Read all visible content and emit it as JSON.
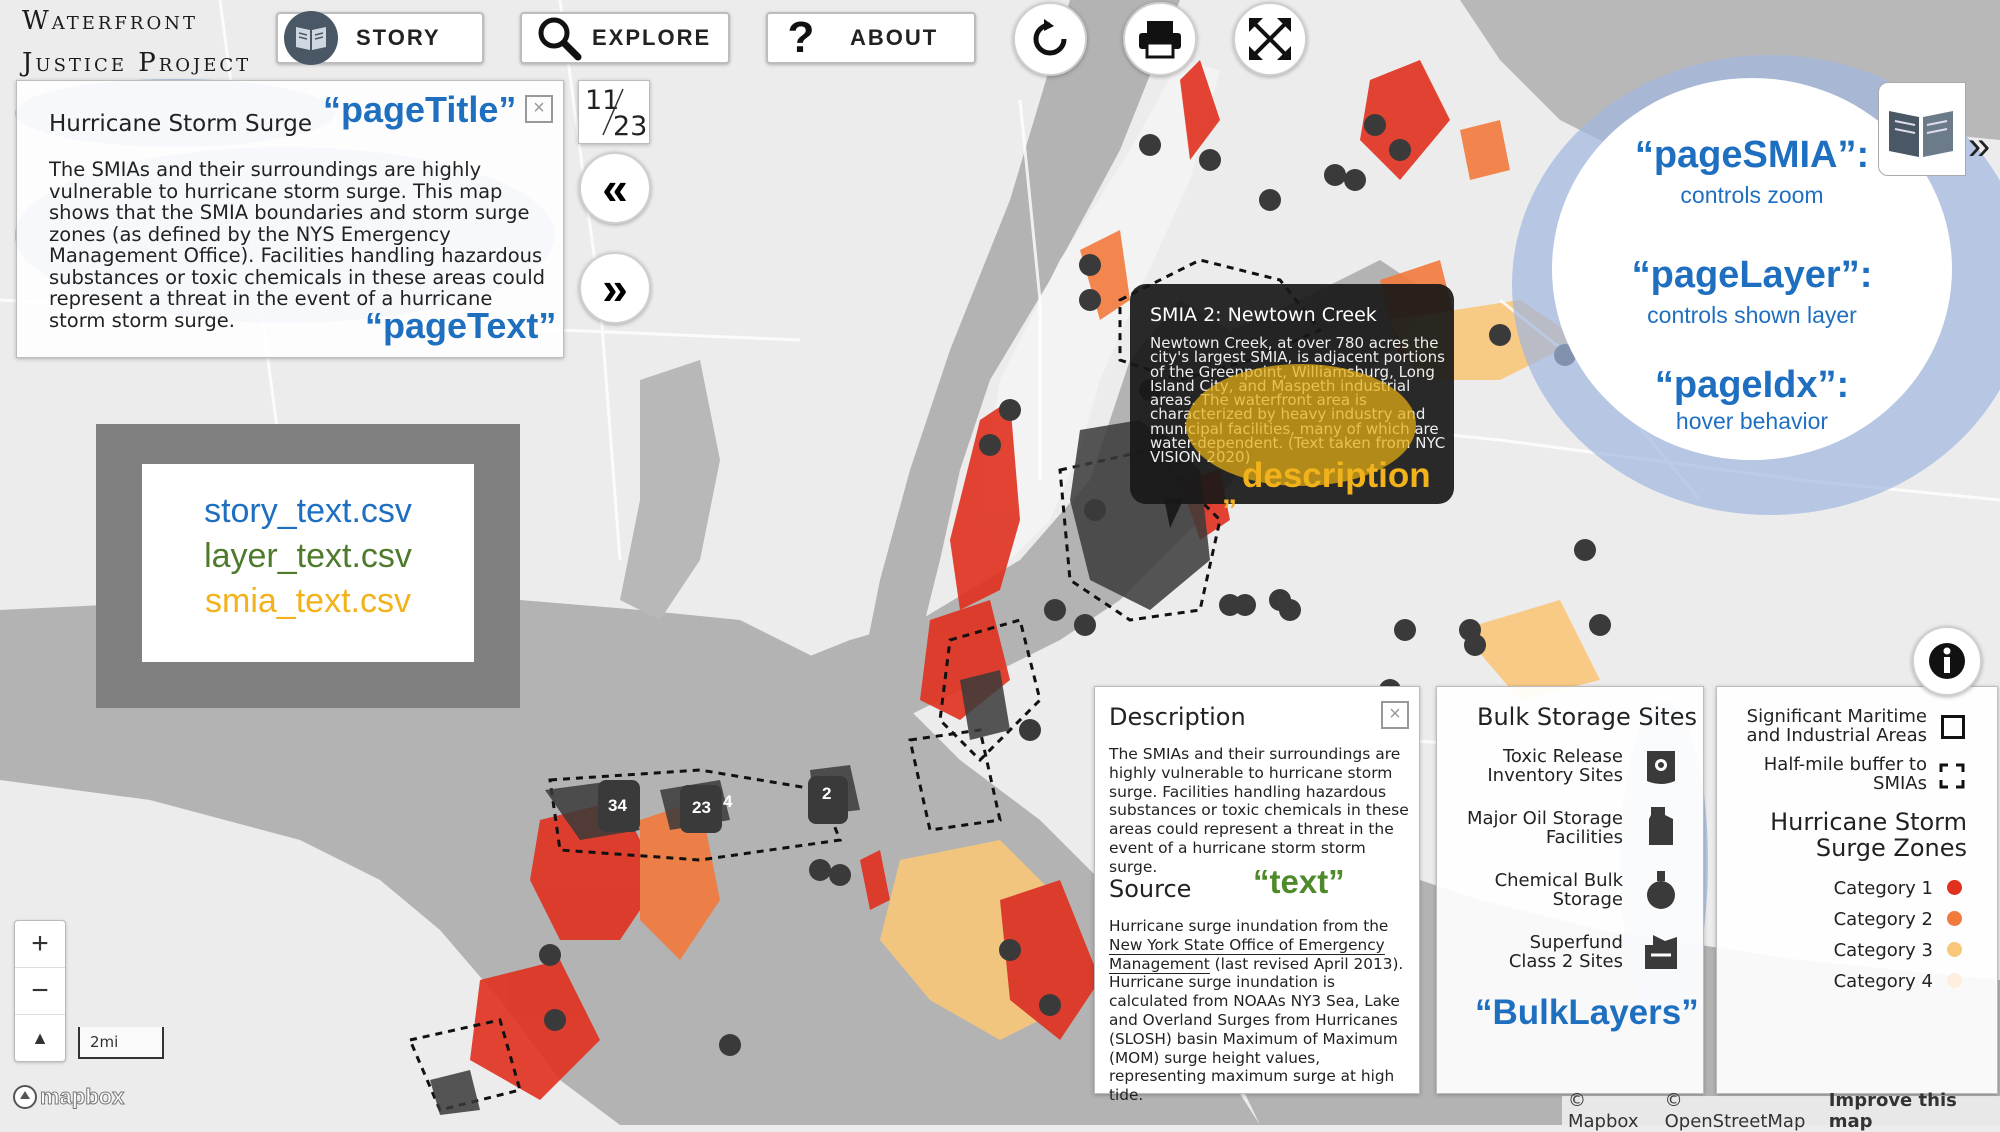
{
  "brand": {
    "line1": "Waterfront",
    "line2": "Justice Project"
  },
  "nav": {
    "story": "STORY",
    "explore": "EXPLORE",
    "about": "ABOUT",
    "explore_glyph": "?"
  },
  "icons": {
    "story": "book-icon",
    "explore": "magnifier-icon",
    "about": "question-icon",
    "reset": "reset-icon",
    "print": "printer-icon",
    "fullscreen": "expand-arrows-icon",
    "info": "info-icon"
  },
  "story_panel": {
    "title": "Hurricane Storm Surge",
    "text": "The SMIAs and their surroundings are highly vulnerable to hurricane storm surge. This map shows that the SMIA boundaries and storm surge zones (as defined by the NYS Emergency Management Office). Facilities handling hazardous substances or toxic chemicals in these areas could represent a threat in the event of a hurricane storm storm surge.",
    "close": "×"
  },
  "page_counter": {
    "current": "11",
    "total": "23"
  },
  "annotations": {
    "pageTitle": "“pageTitle”",
    "pageText": "“pageText”",
    "pageSMIA": "“pageSMIA”:",
    "pageSMIA_desc": "controls zoom",
    "pageLayer": "“pageLayer”:",
    "pageLayer_desc": "controls shown layer",
    "pageIdx": "“pageIdx”:",
    "pageIdx_desc": "hover behavior",
    "description": "description",
    "quote_mark": "”",
    "text": "“text”",
    "bulklayers": "“BulkLayers”"
  },
  "files": {
    "story": "story_text.csv",
    "layer": "layer_text.csv",
    "smia": "smia_text.csv"
  },
  "colors": {
    "story_file": "#1f6fc0",
    "layer_file": "#4e7a2c",
    "smia_file": "#f2b21b",
    "surge_cat1": "#e0301e",
    "surge_cat2": "#f27a3c",
    "surge_cat3": "#f9c77a",
    "surge_cat4": "#fdeedd"
  },
  "tooltip": {
    "title": "SMIA 2: Newtown Creek",
    "body": "Newtown Creek, at over 780 acres the city's largest SMIA, is adjacent portions of the Greenpoint, Williamsburg, Long Island City, and Maspeth industrial areas. The waterfront area is characterized by heavy industry and municipal facilities, many of which are water-dependent. (Text taken from NYC VISION 2020)"
  },
  "description_panel": {
    "heading": "Description",
    "close": "×",
    "text": "The SMIAs and their surroundings are highly vulnerable to hurricane storm surge. Facilities handling hazardous substances or toxic chemicals in these areas could represent a threat in the event of a hurricane storm storm surge.",
    "source_heading": "Source",
    "source_text_1": "Hurricane surge inundation from the",
    "source_link": "New York State Office of Emergency Management",
    "source_text_2": "(last revised April 2013). Hurricane surge inundation is calculated from NOAAs NY3 Sea, Lake and Overland Surges from Hurricanes (SLOSH) basin Maximum of Maximum (MOM) surge height values, representing maximum surge at high tide."
  },
  "bulk_panel": {
    "heading": "Bulk Storage Sites",
    "items": [
      {
        "label_1": "Toxic Release",
        "label_2": "Inventory Sites",
        "icon": "toxic-release-icon"
      },
      {
        "label_1": "Major Oil Storage",
        "label_2": "Facilities",
        "icon": "oil-storage-icon"
      },
      {
        "label_1": "Chemical Bulk",
        "label_2": "Storage",
        "icon": "chemical-bulk-icon"
      },
      {
        "label_1": "Superfund",
        "label_2": "Class 2 Sites",
        "icon": "superfund-icon"
      }
    ]
  },
  "legend_panel": {
    "smia_1": "Significant Maritime",
    "smia_2": "and Industrial Areas",
    "buffer_1": "Half-mile buffer to",
    "buffer_2": "SMIAs",
    "surge_title_1": "Hurricane Storm",
    "surge_title_2": "Surge Zones",
    "categories": [
      "Category 1",
      "Category 2",
      "Category 3",
      "Category 4"
    ]
  },
  "map_labels": {
    "smia_numbers": [
      "34",
      "23",
      "4",
      "2"
    ]
  },
  "scale": "2mi",
  "attribution": {
    "mapbox": "© Mapbox",
    "osm": "© OpenStreetMap",
    "improve": "Improve this map",
    "logo": "mapbox"
  },
  "zoom": {
    "in": "+",
    "out": "−",
    "compass": "▲"
  }
}
